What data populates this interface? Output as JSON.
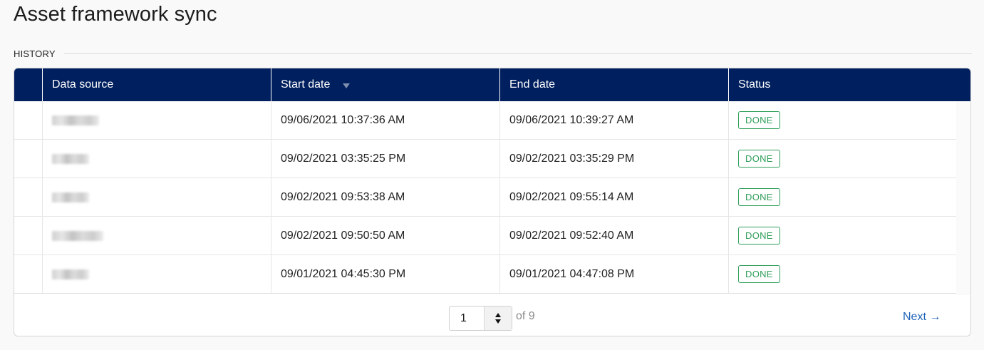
{
  "page": {
    "title": "Asset framework sync"
  },
  "history": {
    "section_label": "HISTORY",
    "columns": [
      {
        "label": ""
      },
      {
        "label": "Data source"
      },
      {
        "label": "Start date",
        "sort": "descending"
      },
      {
        "label": "End date"
      },
      {
        "label": "Status"
      }
    ],
    "rows": [
      {
        "start": "09/06/2021 10:37:36 AM",
        "end": "09/06/2021 10:39:27 AM",
        "status": "DONE"
      },
      {
        "start": "09/02/2021 03:35:25 PM",
        "end": "09/02/2021 03:35:29 PM",
        "status": "DONE"
      },
      {
        "start": "09/02/2021 09:53:38 AM",
        "end": "09/02/2021 09:55:14 AM",
        "status": "DONE"
      },
      {
        "start": "09/02/2021 09:50:50 AM",
        "end": "09/02/2021 09:52:40 AM",
        "status": "DONE"
      },
      {
        "start": "09/01/2021 04:45:30 PM",
        "end": "09/01/2021 04:47:08 PM",
        "status": "DONE"
      }
    ]
  },
  "pagination": {
    "current_page": "1",
    "of_label": "of 9",
    "next_label": "Next →"
  },
  "colors": {
    "header_bg": "#001f5e",
    "done_green": "#2f9e5a",
    "link_blue": "#1f63b8"
  }
}
